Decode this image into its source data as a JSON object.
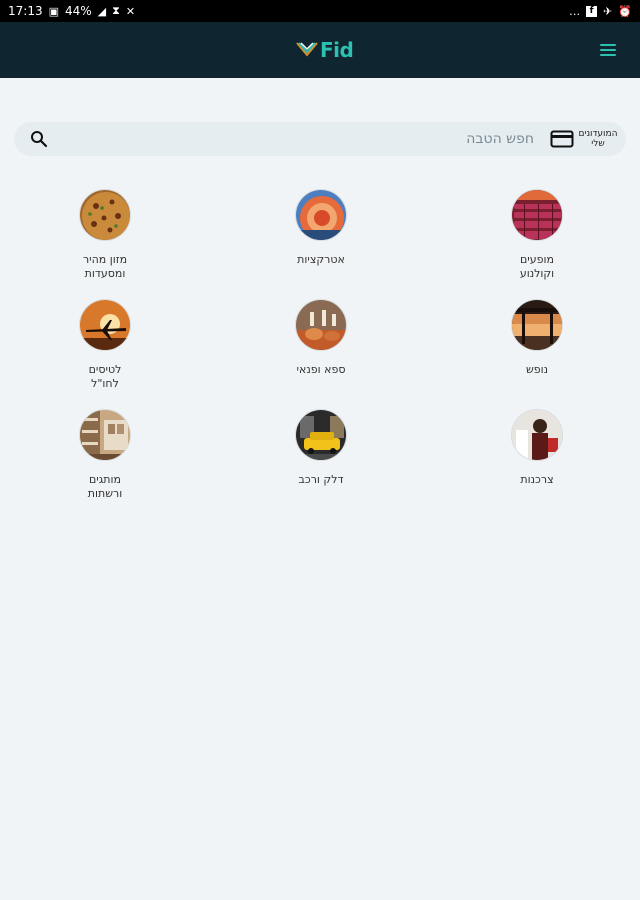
{
  "status_bar": {
    "time": "17:13",
    "battery": "44%",
    "icons_left": [
      "image-icon",
      "signal-icon",
      "hourglass-icon",
      "mute-icon"
    ],
    "icons_right": [
      "more-icon",
      "facebook-icon",
      "airplane-check-icon",
      "alarm-icon"
    ]
  },
  "app_bar": {
    "logo_text": "Fid",
    "colors": {
      "background": "#0f2631",
      "accent": "#2cc1b0"
    }
  },
  "search": {
    "placeholder": "חפש הטבה",
    "value": "",
    "my_cards_label_line1": "המועדונים",
    "my_cards_label_line2": "שלי"
  },
  "categories": [
    {
      "id": "shows",
      "line1": "מופעים",
      "line2": "וקולנוע",
      "image": "theater-seats"
    },
    {
      "id": "attractions",
      "line1": "אטרקציות",
      "line2": "",
      "image": "ride"
    },
    {
      "id": "fastfood",
      "line1": "מזון מהיר",
      "line2": "ומסעדות",
      "image": "pizza"
    },
    {
      "id": "vacation",
      "line1": "נופש",
      "line2": "",
      "image": "beach-sunset"
    },
    {
      "id": "spa",
      "line1": "ספא ופנאי",
      "line2": "",
      "image": "spa"
    },
    {
      "id": "flights",
      "line1": "לטיסים",
      "line2": "לחו\"ל",
      "image": "airplane"
    },
    {
      "id": "shopping",
      "line1": "צרכנות",
      "line2": "",
      "image": "shopping-person"
    },
    {
      "id": "fuel",
      "line1": "דלק ורכב",
      "line2": "",
      "image": "taxi"
    },
    {
      "id": "brands",
      "line1": "מותגים",
      "line2": "ורשתות",
      "image": "store"
    }
  ]
}
